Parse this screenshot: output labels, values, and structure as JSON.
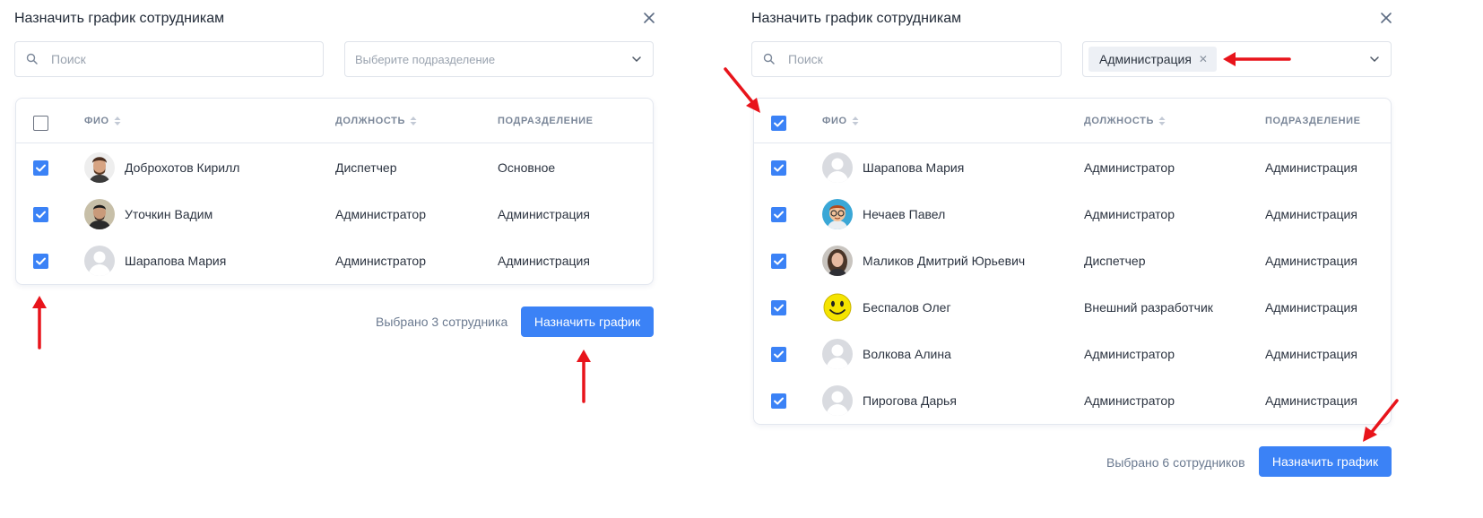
{
  "left": {
    "title": "Назначить график сотрудникам",
    "search_placeholder": "Поиск",
    "department_placeholder": "Выберите подразделение",
    "columns": {
      "name": "ФИО",
      "position": "ДОЛЖНОСТЬ",
      "department": "ПОДРАЗДЕЛЕНИЕ"
    },
    "select_all_checked": false,
    "rows": [
      {
        "name": "Доброхотов Кирилл",
        "position": "Диспетчер",
        "department": "Основное",
        "avatar": "photo-man-beard",
        "checked": true
      },
      {
        "name": "Уточкин Вадим",
        "position": "Администратор",
        "department": "Администрация",
        "avatar": "photo-man-dark",
        "checked": true
      },
      {
        "name": "Шарапова Мария",
        "position": "Администратор",
        "department": "Администрация",
        "avatar": "default-avatar",
        "checked": true
      }
    ],
    "selected_text": "Выбрано 3 сотрудника",
    "assign_button": "Назначить график"
  },
  "right": {
    "title": "Назначить график сотрудникам",
    "search_placeholder": "Поиск",
    "department_tag": "Администрация",
    "columns": {
      "name": "ФИО",
      "position": "ДОЛЖНОСТЬ",
      "department": "ПОДРАЗДЕЛЕНИЕ"
    },
    "select_all_checked": true,
    "rows": [
      {
        "name": "Шарапова Мария",
        "position": "Администратор",
        "department": "Администрация",
        "avatar": "default-avatar",
        "checked": true
      },
      {
        "name": "Нечаев Павел",
        "position": "Администратор",
        "department": "Администрация",
        "avatar": "cartoon-glasses",
        "checked": true
      },
      {
        "name": "Маликов Дмитрий Юрьевич",
        "position": "Диспетчер",
        "department": "Администрация",
        "avatar": "photo-woman",
        "checked": true
      },
      {
        "name": "Беспалов Олег",
        "position": "Внешний разработчик",
        "department": "Администрация",
        "avatar": "smiley",
        "checked": true
      },
      {
        "name": "Волкова Алина",
        "position": "Администратор",
        "department": "Администрация",
        "avatar": "default-avatar",
        "checked": true
      },
      {
        "name": "Пирогова Дарья",
        "position": "Администратор",
        "department": "Администрация",
        "avatar": "default-avatar",
        "checked": true
      }
    ],
    "selected_text": "Выбрано 6 сотрудников",
    "assign_button": "Назначить график"
  },
  "colors": {
    "accent": "#3b82f6",
    "annotation_arrow": "#e8141b",
    "border": "#e3e7ef"
  }
}
